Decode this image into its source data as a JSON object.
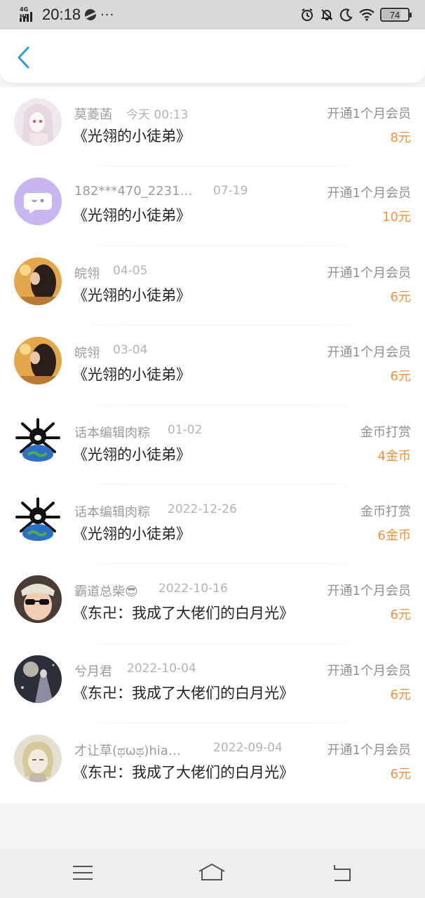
{
  "status_bar": {
    "network": "4G HD",
    "time": "20:18",
    "more": "···",
    "battery": "74",
    "battery_level": 0.74,
    "icons": [
      "signal-icon",
      "vpn-icon",
      "alarm-icon",
      "mute-icon",
      "moon-icon",
      "wifi-icon",
      "battery-icon"
    ]
  },
  "header": {
    "back_icon": "chevron-left-icon",
    "accent_color": "#2f9ae0"
  },
  "records": [
    {
      "name": "莫菱菡",
      "date": "今天 00:13",
      "book": "《光翎的小徒弟》",
      "action": "开通1个月会员",
      "amount": "8元"
    },
    {
      "name": "182***470_2231…",
      "date": "07-19",
      "book": "《光翎的小徒弟》",
      "action": "开通1个月会员",
      "amount": "10元"
    },
    {
      "name": "皖翎",
      "date": "04-05",
      "book": "《光翎的小徒弟》",
      "action": "开通1个月会员",
      "amount": "6元"
    },
    {
      "name": "皖翎",
      "date": "03-04",
      "book": "《光翎的小徒弟》",
      "action": "开通1个月会员",
      "amount": "6元"
    },
    {
      "name": "话本编辑肉粽",
      "date": "01-02",
      "book": "《光翎的小徒弟》",
      "action": "金币打赏",
      "amount": "4金币"
    },
    {
      "name": "话本编辑肉粽",
      "date": "2022-12-26",
      "book": "《光翎的小徒弟》",
      "action": "金币打赏",
      "amount": "6金币"
    },
    {
      "name": "霸道总柴😎",
      "date": "2022-10-16",
      "book": "《东卍：我成了大佬们的白月光》",
      "action": "开通1个月会员",
      "amount": "6元"
    },
    {
      "name": "兮月君",
      "date": "2022-10-04",
      "book": "《东卍：我成了大佬们的白月光》",
      "action": "开通1个月会员",
      "amount": "6元"
    },
    {
      "name": "才让草(ಥωಥ)hia…",
      "date": "2022-09-04",
      "book": "《东卍：我成了大佬们的白月光》",
      "action": "开通1个月会员",
      "amount": "6元"
    }
  ],
  "colors": {
    "amount": "#f0913a",
    "name": "#9b9b9b",
    "book": "#222222"
  },
  "nav_bar": {
    "icons": [
      "menu-icon",
      "home-icon",
      "back-icon"
    ]
  }
}
